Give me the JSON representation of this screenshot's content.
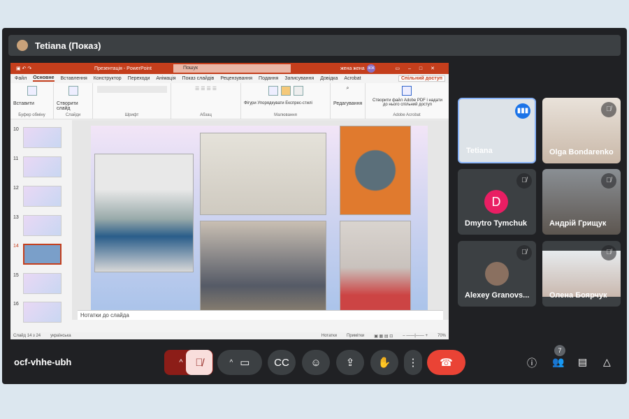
{
  "meeting": {
    "presenter_label": "Tetiana (Показ)",
    "code": "ocf-vhhe-ubh",
    "participant_count": "7"
  },
  "ppt": {
    "title": "Презентація - PowerPoint",
    "search": "Пошук",
    "user": "жена жена",
    "user_initials": "ЖЖ",
    "menus": [
      "Файл",
      "Основне",
      "Вставлення",
      "Конструктор",
      "Переходи",
      "Анімація",
      "Показ слайдів",
      "Рецензування",
      "Подання",
      "Записування",
      "Довідка",
      "Acrobat"
    ],
    "share": "Спільний доступ",
    "groups": [
      {
        "label": "Буфер обміну",
        "btn": "Вставити"
      },
      {
        "label": "Слайди",
        "btn": "Створити слайд"
      },
      {
        "label": "Шрифт",
        "btn": ""
      },
      {
        "label": "Абзац",
        "btn": ""
      },
      {
        "label": "Малювання",
        "btn": "Фігури  Упорядкувати  Експрес-стилі"
      },
      {
        "label": "",
        "btn": "Редагування"
      },
      {
        "label": "Adobe Acrobat",
        "btn": "Створити файл Adobe PDF і надати до нього спільний доступ"
      }
    ],
    "thumbs": [
      "10",
      "11",
      "12",
      "13",
      "14",
      "15",
      "16"
    ],
    "selected_slide": "14",
    "notes": "Нотатки до слайда",
    "status": {
      "slide": "Слайд 14 з 24",
      "lang": "українська",
      "notes": "Нотатки",
      "comments": "Примітки",
      "zoom": "70%"
    }
  },
  "participants": [
    {
      "name": "Tetiana",
      "speaking": true
    },
    {
      "name": "Olga Bondarenko"
    },
    {
      "name": "Dmytro Tymchuk",
      "initial": "D"
    },
    {
      "name": "Андрій Грищук"
    },
    {
      "name": "Alexey Granovs..."
    },
    {
      "name": "Олена Боярчук"
    }
  ],
  "colors": {
    "end_call": "#ea4335",
    "accent": "#8ab4f8",
    "ppt": "#c43e1c"
  }
}
